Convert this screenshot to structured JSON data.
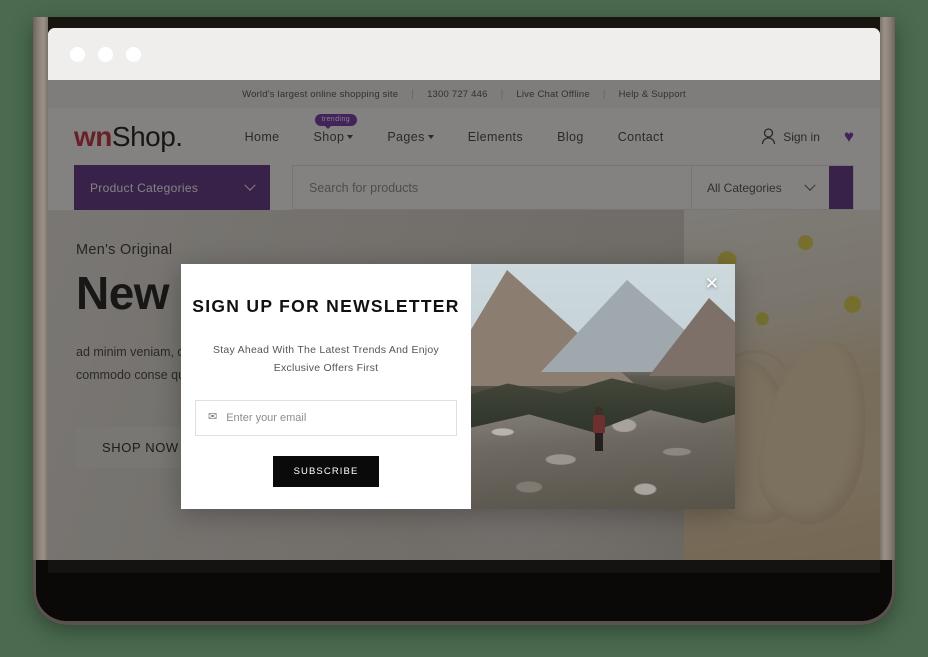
{
  "window": {
    "traffic_lights": [
      "close",
      "minimize",
      "maximize"
    ]
  },
  "site": {
    "topbar": {
      "tagline": "World's largest online shopping site",
      "phone": "1300 727 446",
      "chat": "Live Chat Offline",
      "support": "Help & Support",
      "separator": "|"
    },
    "header": {
      "logo_accent": "wn",
      "logo_rest": "Shop.",
      "nav": [
        {
          "label": "Home",
          "has_caret": false
        },
        {
          "label": "Shop",
          "has_caret": true
        },
        {
          "label": "Pages",
          "has_caret": true
        },
        {
          "label": "Elements",
          "has_caret": false
        },
        {
          "label": "Blog",
          "has_caret": false
        },
        {
          "label": "Contact",
          "has_caret": false
        }
      ],
      "trending_badge": "trending",
      "signin_label": "Sign in",
      "wishlist_icon": "heart-icon",
      "accent_color": "#6f2da8"
    },
    "search": {
      "categories_button": "Product Categories",
      "placeholder": "Search for products",
      "value": "",
      "all_categories": "All Categories",
      "purple": "#5b2a86"
    },
    "hero": {
      "eyebrow": "Men's Original",
      "title": "New Shoes",
      "description": "ad minim veniam, quis nostrud exercitation ullamco laboris nisi ut aliquip ex ea commodo conse quat. Duis aute irure dolor in reprehenderit in voluptate.",
      "cta": "SHOP NOW"
    }
  },
  "modal": {
    "title": "SIGN UP FOR NEWSLETTER",
    "subtitle": "Stay Ahead With The Latest Trends And Enjoy Exclusive Offers First",
    "email_placeholder": "Enter your email",
    "email_value": "",
    "mail_icon": "envelope-icon",
    "subscribe_label": "SUBSCRIBE",
    "close_icon": "close-icon",
    "image_alt": "hiker-on-mountain-photo"
  }
}
